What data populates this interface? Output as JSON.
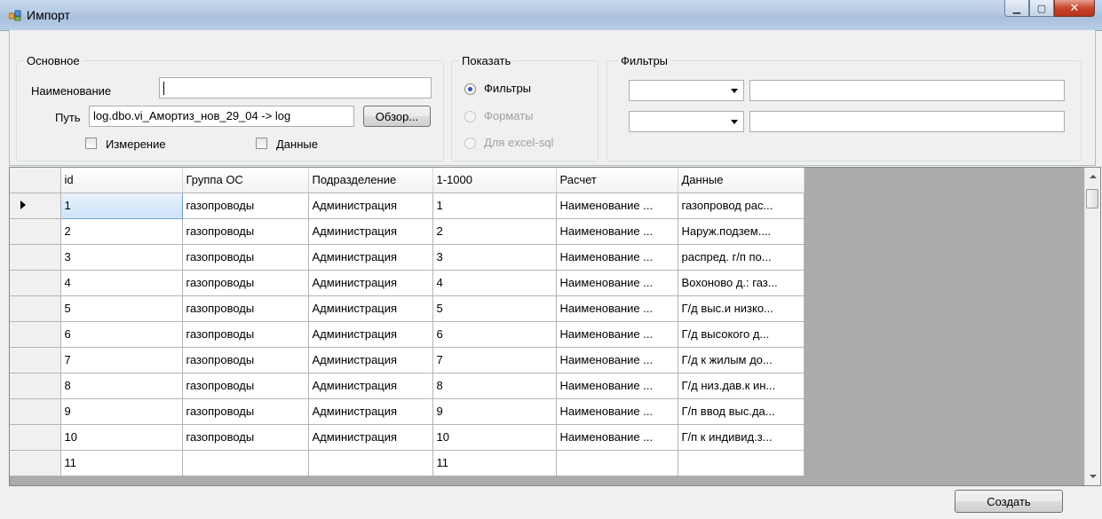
{
  "window": {
    "title": "Импорт",
    "controls": [
      "minimize",
      "maximize",
      "close"
    ]
  },
  "main_group": {
    "title": "Основное",
    "name_label": "Наименование",
    "name_value": "",
    "path_label": "Путь",
    "path_value": "log.dbo.vi_Амортиз_нов_29_04 -> log",
    "browse_button": "Обзор...",
    "measure_checkbox": "Измерение",
    "data_checkbox": "Данные"
  },
  "show_group": {
    "title": "Показать",
    "options": [
      "Фильтры",
      "Форматы",
      "Для excel-sql"
    ],
    "selected": "Фильтры"
  },
  "filters_group": {
    "title": "Фильтры"
  },
  "grid": {
    "columns": [
      "id",
      "Группа ОС",
      "Подразделение",
      "1-1000",
      "Расчет",
      "Данные"
    ],
    "rows": [
      [
        "1",
        "газопроводы",
        "Администрация",
        "1",
        "Наименование ...",
        "газопровод рас..."
      ],
      [
        "2",
        "газопроводы",
        "Администрация",
        "2",
        "Наименование ...",
        "Наруж.подзем...."
      ],
      [
        "3",
        "газопроводы",
        "Администрация",
        "3",
        "Наименование ...",
        "распред. г/п по..."
      ],
      [
        "4",
        "газопроводы",
        "Администрация",
        "4",
        "Наименование ...",
        "Вохоново д.: газ..."
      ],
      [
        "5",
        "газопроводы",
        "Администрация",
        "5",
        "Наименование ...",
        "Г/д выс.и низко..."
      ],
      [
        "6",
        "газопроводы",
        "Администрация",
        "6",
        "Наименование ...",
        "Г/д высокого д..."
      ],
      [
        "7",
        "газопроводы",
        "Администрация",
        "7",
        "Наименование ...",
        "Г/д к жилым до..."
      ],
      [
        "8",
        "газопроводы",
        "Администрация",
        "8",
        "Наименование ...",
        "Г/д низ.дав.к ин..."
      ],
      [
        "9",
        "газопроводы",
        "Администрация",
        "9",
        "Наименование ...",
        "Г/п ввод выс.да..."
      ],
      [
        "10",
        "газопроводы",
        "Администрация",
        "10",
        "Наименование ...",
        "Г/п к индивид.з..."
      ],
      [
        "11",
        "",
        "",
        "11",
        "",
        ""
      ]
    ],
    "current_row": "1"
  },
  "create_button": "Создать"
}
